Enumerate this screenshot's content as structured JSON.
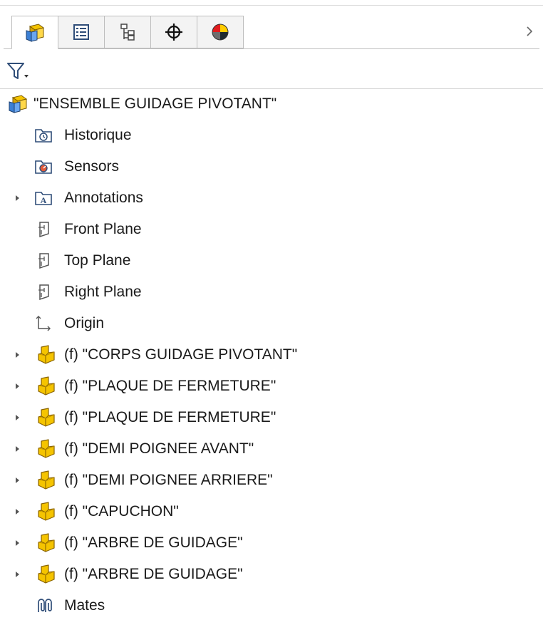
{
  "tabs": [
    {
      "name": "tab-feature-manager",
      "icon": "assembly-icon",
      "active": true
    },
    {
      "name": "tab-property-manager",
      "icon": "property-list-icon",
      "active": false
    },
    {
      "name": "tab-configuration-manager",
      "icon": "configuration-icon",
      "active": false
    },
    {
      "name": "tab-dimxpert-manager",
      "icon": "crosshair-icon",
      "active": false
    },
    {
      "name": "tab-display-manager",
      "icon": "display-sphere-icon",
      "active": false
    }
  ],
  "tree": {
    "root": {
      "label": "\"ENSEMBLE GUIDAGE PIVOTANT\"",
      "icon": "assembly-icon"
    },
    "items": [
      {
        "label": "Historique",
        "icon": "history-folder-icon",
        "expandable": false
      },
      {
        "label": "Sensors",
        "icon": "sensors-folder-icon",
        "expandable": false
      },
      {
        "label": "Annotations",
        "icon": "annotations-folder-icon",
        "expandable": true
      },
      {
        "label": "Front Plane",
        "icon": "plane-icon",
        "expandable": false
      },
      {
        "label": "Top Plane",
        "icon": "plane-icon",
        "expandable": false
      },
      {
        "label": "Right Plane",
        "icon": "plane-icon",
        "expandable": false
      },
      {
        "label": "Origin",
        "icon": "origin-icon",
        "expandable": false
      },
      {
        "label": "(f) \"CORPS GUIDAGE PIVOTANT\"",
        "icon": "part-icon",
        "expandable": true
      },
      {
        "label": "(f) \"PLAQUE DE FERMETURE\"",
        "icon": "part-icon",
        "expandable": true
      },
      {
        "label": "(f) \"PLAQUE DE FERMETURE\"",
        "icon": "part-icon",
        "expandable": true
      },
      {
        "label": "(f) \"DEMI POIGNEE AVANT\"",
        "icon": "part-icon",
        "expandable": true
      },
      {
        "label": "(f) \"DEMI POIGNEE ARRIERE\"",
        "icon": "part-icon",
        "expandable": true
      },
      {
        "label": "(f) \"CAPUCHON\"",
        "icon": "part-icon",
        "expandable": true
      },
      {
        "label": "(f) \"ARBRE DE GUIDAGE\"",
        "icon": "part-icon",
        "expandable": true
      },
      {
        "label": "(f) \"ARBRE DE GUIDAGE\"",
        "icon": "part-icon",
        "expandable": true
      },
      {
        "label": "Mates",
        "icon": "mates-icon",
        "expandable": false
      }
    ]
  },
  "colors": {
    "part_yellow": "#f5c400",
    "assembly_blue": "#3b7fd4",
    "icon_outline": "#2f4d78"
  }
}
